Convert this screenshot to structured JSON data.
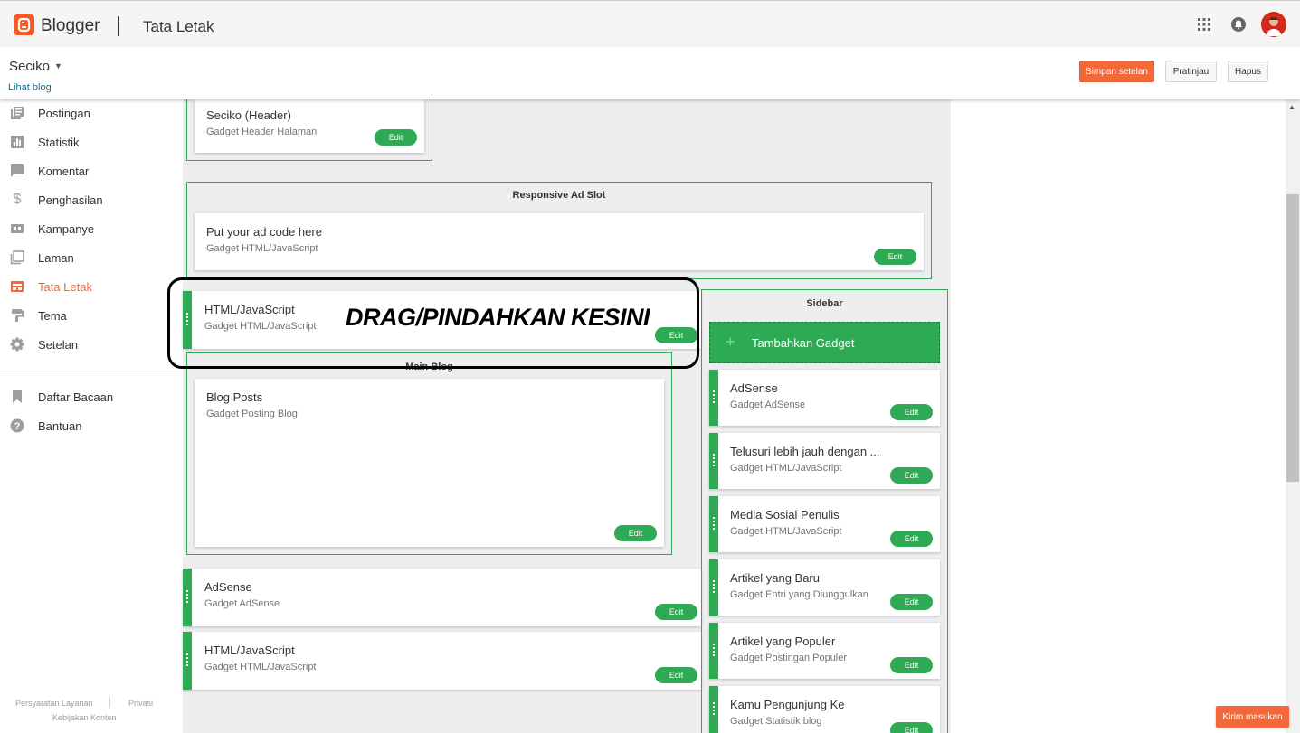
{
  "app": {
    "brand": "Blogger",
    "page_title": "Tata Letak"
  },
  "header": {
    "blog_name": "Seciko",
    "view_blog": "Lihat blog",
    "save_label": "Simpan setelan",
    "preview_label": "Pratinjau",
    "delete_label": "Hapus"
  },
  "nav": {
    "items": [
      {
        "label": "Postingan",
        "icon": "posts-icon"
      },
      {
        "label": "Statistik",
        "icon": "stats-icon"
      },
      {
        "label": "Komentar",
        "icon": "comments-icon"
      },
      {
        "label": "Penghasilan",
        "icon": "earnings-icon"
      },
      {
        "label": "Kampanye",
        "icon": "campaigns-icon"
      },
      {
        "label": "Laman",
        "icon": "pages-icon"
      },
      {
        "label": "Tata Letak",
        "icon": "layout-icon",
        "active": true
      },
      {
        "label": "Tema",
        "icon": "theme-icon"
      },
      {
        "label": "Setelan",
        "icon": "settings-icon"
      }
    ],
    "secondary": [
      {
        "label": "Daftar Bacaan",
        "icon": "bookmark-icon"
      },
      {
        "label": "Bantuan",
        "icon": "help-icon"
      }
    ],
    "footer": {
      "terms": "Persyaratan Layanan",
      "privacy": "Privasi",
      "content_policy": "Kebijakan Konten"
    }
  },
  "layout": {
    "header_gadget": {
      "title": "Seciko (Header)",
      "subtitle": "Gadget Header Halaman",
      "edit": "Edit"
    },
    "ad_slot": {
      "section_title": "Responsive Ad Slot",
      "gadget": {
        "title": "Put your ad code here",
        "subtitle": "Gadget HTML/JavaScript",
        "edit": "Edit"
      }
    },
    "dragged_gadget": {
      "title": "HTML/JavaScript",
      "subtitle": "Gadget HTML/JavaScript",
      "edit": "Edit"
    },
    "main_blog": {
      "section_title": "Main Blog",
      "gadget": {
        "title": "Blog Posts",
        "subtitle": "Gadget Posting Blog",
        "edit": "Edit"
      }
    },
    "below_gadgets": [
      {
        "title": "AdSense",
        "subtitle": "Gadget AdSense",
        "edit": "Edit"
      },
      {
        "title": "HTML/JavaScript",
        "subtitle": "Gadget HTML/JavaScript",
        "edit": "Edit"
      }
    ],
    "sidebar": {
      "section_title": "Sidebar",
      "add_gadget": "Tambahkan Gadget",
      "gadgets": [
        {
          "title": "AdSense",
          "subtitle": "Gadget AdSense",
          "edit": "Edit"
        },
        {
          "title": "Telusuri lebih jauh dengan ...",
          "subtitle": "Gadget HTML/JavaScript",
          "edit": "Edit"
        },
        {
          "title": "Media Sosial Penulis",
          "subtitle": "Gadget HTML/JavaScript",
          "edit": "Edit"
        },
        {
          "title": "Artikel yang Baru",
          "subtitle": "Gadget Entri yang Diunggulkan",
          "edit": "Edit"
        },
        {
          "title": "Artikel yang Populer",
          "subtitle": "Gadget Postingan Populer",
          "edit": "Edit"
        },
        {
          "title": "Kamu Pengunjung Ke",
          "subtitle": "Gadget Statistik blog",
          "edit": "Edit"
        }
      ]
    }
  },
  "annotation": {
    "text": "DRAG/PINDAHKAN KESINI"
  },
  "feedback": {
    "label": "Kirim masukan"
  },
  "colors": {
    "accent": "#f26838",
    "green": "#2eaa55",
    "brand": "#ff5722"
  }
}
